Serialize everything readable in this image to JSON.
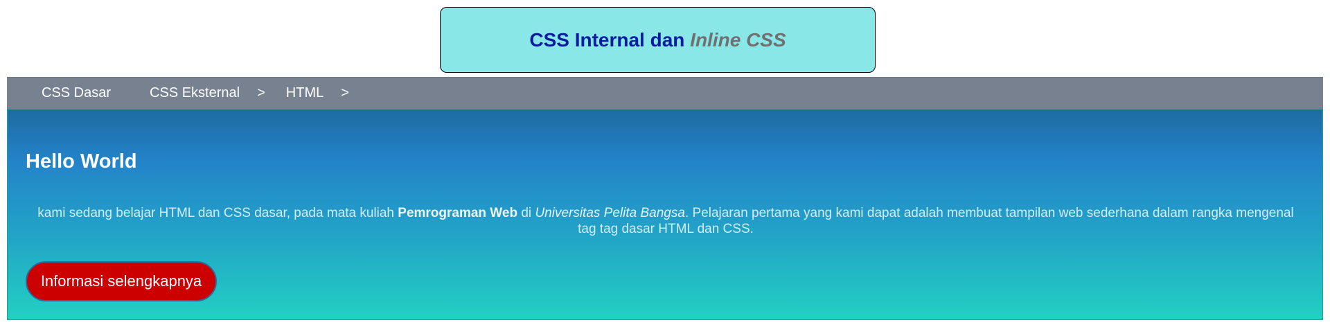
{
  "header": {
    "title_main": "CSS Internal dan ",
    "title_em": "Inline CSS"
  },
  "nav": {
    "items": [
      {
        "label": "CSS Dasar",
        "separator": ""
      },
      {
        "label": "CSS Eksternal",
        "separator": ">"
      },
      {
        "label": "HTML",
        "separator": ">"
      }
    ]
  },
  "main": {
    "heading": "Hello World",
    "paragraph": {
      "part1": "kami sedang belajar HTML dan CSS dasar, pada mata kuliah ",
      "bold": "Pemrograman Web",
      "part2": " di ",
      "italic": "Universitas Pelita Bangsa",
      "part3": ". Pelajaran pertama yang kami dapat adalah membuat tampilan web sederhana dalam rangka mengenal tag tag dasar HTML dan CSS."
    },
    "button_label": "Informasi selengkapnya"
  },
  "colors": {
    "header_bg": "#8ae7e8",
    "title_main": "#0b1c9e",
    "title_em": "#707070",
    "nav_bg": "#778190",
    "gradient_top": "#1e6ba3",
    "gradient_bottom": "#22d0c2",
    "button_bg": "#cc0000"
  }
}
